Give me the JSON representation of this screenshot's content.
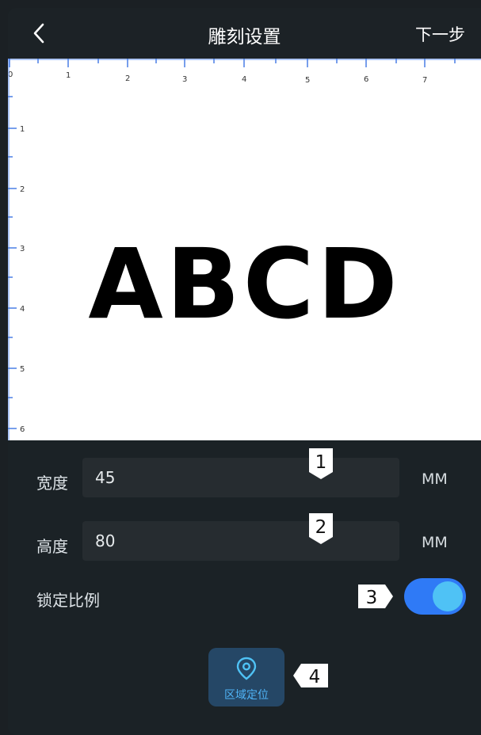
{
  "header": {
    "back_icon": "chevron-left-icon",
    "title": "雕刻设置",
    "next_label": "下一步"
  },
  "canvas": {
    "sample_text": "ABCD",
    "ruler_top_labels": [
      "0",
      "1",
      "2",
      "3",
      "4",
      "5",
      "6",
      "7"
    ],
    "ruler_left_labels": [
      "1",
      "2",
      "3",
      "4",
      "5",
      "6"
    ]
  },
  "settings": {
    "width_label": "宽度",
    "width_value": "45",
    "width_unit": "MM",
    "height_label": "高度",
    "height_value": "80",
    "height_unit": "MM",
    "lock_ratio_label": "锁定比例",
    "lock_ratio_on": true,
    "toggle_color": "#2f7af6",
    "area_position_icon": "location-pin-icon",
    "area_position_label": "区域定位"
  },
  "callouts": [
    "1",
    "2",
    "3",
    "4"
  ]
}
